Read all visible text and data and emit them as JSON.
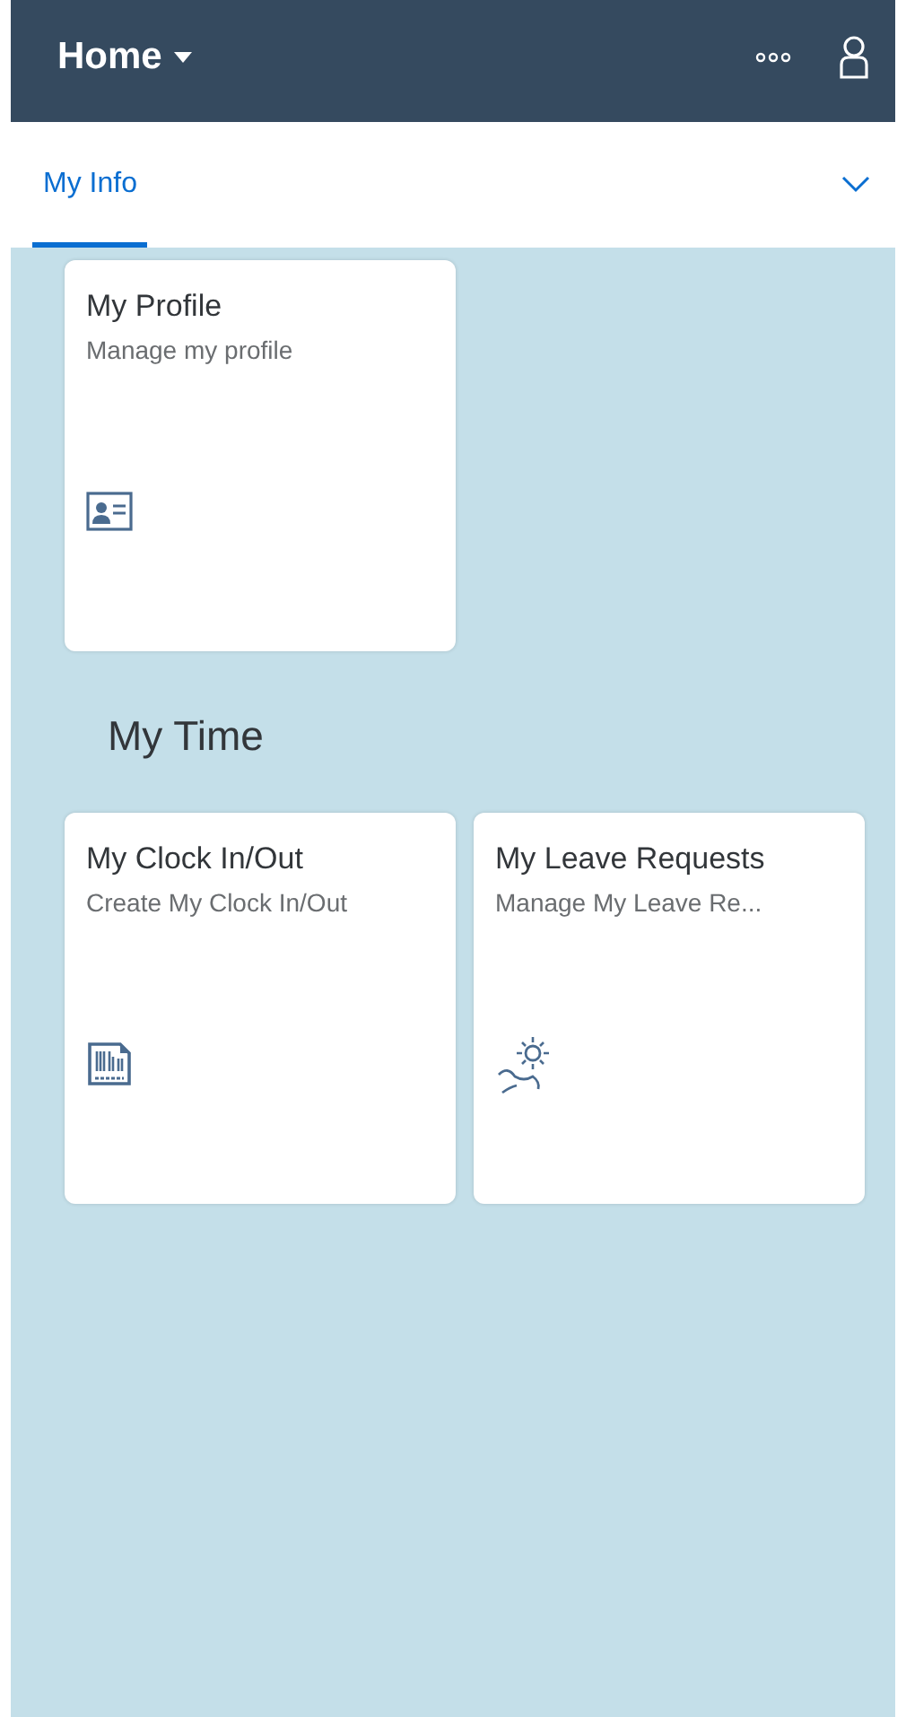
{
  "header": {
    "title": "Home"
  },
  "tabs": [
    {
      "label": "My Info",
      "selected": true
    }
  ],
  "groups": [
    {
      "tiles": [
        {
          "kind": "profile",
          "title": "My Profile",
          "subtitle": "Manage my profile"
        }
      ]
    },
    {
      "title": "My Time",
      "tiles": [
        {
          "kind": "barcode",
          "title": "My Clock In/Out",
          "subtitle": "Create My Clock In/Out"
        },
        {
          "kind": "vacation",
          "title": "My Leave Requests",
          "subtitle": "Manage My Leave Re..."
        }
      ]
    }
  ]
}
